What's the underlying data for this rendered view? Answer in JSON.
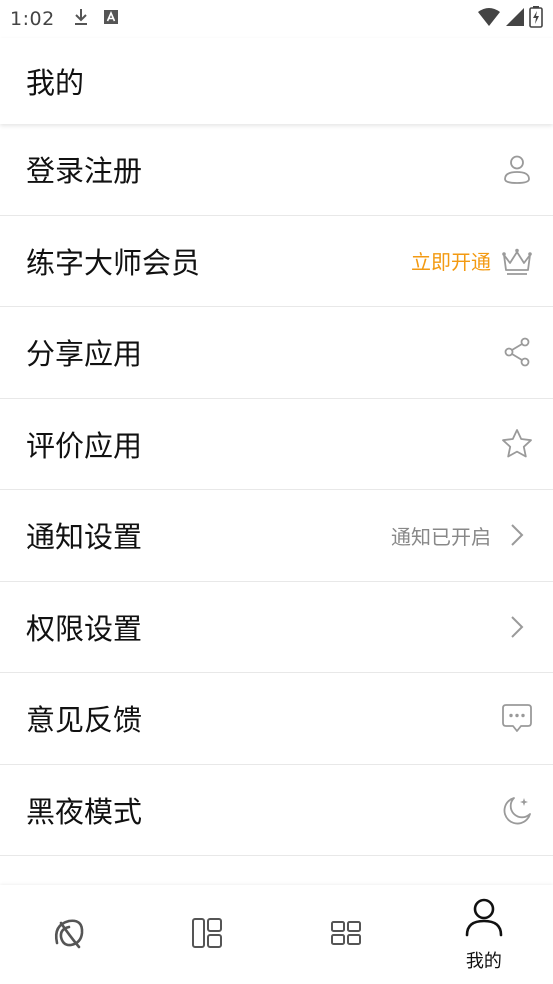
{
  "status_bar": {
    "time": "1:02",
    "left_icons": [
      "download-icon",
      "a-badge-icon"
    ],
    "right_icons": [
      "wifi-icon",
      "signal-icon",
      "battery-icon"
    ]
  },
  "header": {
    "title": "我的"
  },
  "menu": [
    {
      "label": "登录注册",
      "value": "",
      "icon": "person-icon"
    },
    {
      "label": "练字大师会员",
      "value": "立即开通",
      "value_color": "#f39a12",
      "icon": "crown-icon"
    },
    {
      "label": "分享应用",
      "value": "",
      "icon": "share-icon"
    },
    {
      "label": "评价应用",
      "value": "",
      "icon": "star-icon"
    },
    {
      "label": "通知设置",
      "value": "通知已开启",
      "icon": "chevron-right-icon"
    },
    {
      "label": "权限设置",
      "value": "",
      "icon": "chevron-right-icon"
    },
    {
      "label": "意见反馈",
      "value": "",
      "icon": "chat-bubble-icon"
    },
    {
      "label": "黑夜模式",
      "value": "",
      "icon": "moon-icon"
    }
  ],
  "bottom_nav": [
    {
      "label": "",
      "icon": "logo-brush-icon",
      "active": false
    },
    {
      "label": "",
      "icon": "layout-panels-icon",
      "active": false
    },
    {
      "label": "",
      "icon": "grid-icon",
      "active": false
    },
    {
      "label": "我的",
      "icon": "person-icon",
      "active": true
    }
  ],
  "colors": {
    "accent": "#f39a12",
    "icon_gray": "#9a9a9a",
    "divider": "#e8e8e8"
  }
}
